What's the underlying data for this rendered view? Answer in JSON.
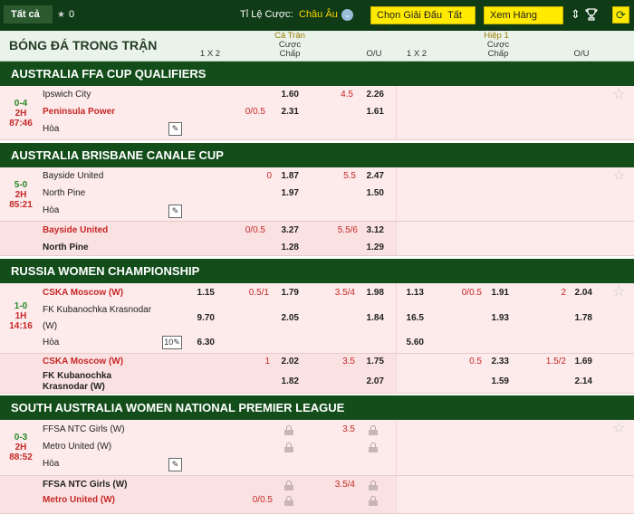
{
  "topbar": {
    "tab_all": "Tất cả",
    "count": "0",
    "odds_label": "Tỉ Lệ Cược:",
    "odds_value": "Châu Âu",
    "choose_league_button": "Chọn Giải Đấu",
    "choose_league_value": "Tất cả",
    "view_single_button": "Xem Hàng Đơn"
  },
  "header": {
    "title": "BÓNG ĐÁ TRONG TRẬN",
    "full_time": "Cả Trận",
    "first_half": "Hiệp 1",
    "col_1x2": "1 X 2",
    "col_handicap_line1": "Cược",
    "col_handicap_line2": "Chấp",
    "col_ou": "O/U"
  },
  "leagues": [
    {
      "name": "AUSTRALIA FFA CUP QUALIFIERS"
    },
    {
      "name": "AUSTRALIA BRISBANE CANALE CUP"
    },
    {
      "name": "RUSSIA WOMEN CHAMPIONSHIP"
    },
    {
      "name": "SOUTH AUSTRALIA WOMEN NATIONAL PREMIER LEAGUE"
    }
  ],
  "matches": {
    "m1": {
      "score": "0-4",
      "period": "2H",
      "clock": "87:46",
      "home": "Ipswich City",
      "away": "Peninsula Power",
      "draw": "Hòa",
      "hc_line": "0/0.5",
      "hc_home": "1.60",
      "hc_away": "2.31",
      "ou_line": "4.5",
      "ou_over": "2.26",
      "ou_under": "1.61"
    },
    "m2": {
      "score": "5-0",
      "period": "2H",
      "clock": "85:21",
      "home": "Bayside United",
      "away": "North Pine",
      "draw": "Hòa",
      "hc_line": "0",
      "hc_home": "1.87",
      "hc_away": "1.97",
      "ou_line": "5.5",
      "ou_over": "2.47",
      "ou_under": "1.50",
      "alt_home": "Bayside United",
      "alt_away": "North Pine",
      "alt_hc_line": "0/0.5",
      "alt_hc_home": "3.27",
      "alt_hc_away": "1.28",
      "alt_ou_line": "5.5/6",
      "alt_ou_over": "3.12",
      "alt_ou_under": "1.29"
    },
    "m3": {
      "score": "1-0",
      "period": "1H",
      "clock": "14:16",
      "home": "CSKA Moscow (W)",
      "away_line1": "FK Kubanochka Krasnodar",
      "away_line2": "(W)",
      "draw": "Hòa",
      "ft_1x2_home": "1.15",
      "ft_1x2_away": "9.70",
      "ft_1x2_draw": "6.30",
      "hc_line": "0.5/1",
      "hc_home": "1.79",
      "hc_away": "2.05",
      "ou_line": "3.5/4",
      "ou_over": "1.98",
      "ou_under": "1.84",
      "h1_1x2_home": "1.13",
      "h1_1x2_away": "16.5",
      "h1_1x2_draw": "5.60",
      "h1_hc_line": "0/0.5",
      "h1_hc_home": "1.91",
      "h1_hc_away": "1.93",
      "h1_ou_line": "2",
      "h1_ou_over": "2.04",
      "h1_ou_under": "1.78",
      "alt_home": "CSKA Moscow (W)",
      "alt_away_line1": "FK Kubanochka",
      "alt_away_line2": "Krasnodar (W)",
      "alt_hc_line": "1",
      "alt_hc_home": "2.02",
      "alt_hc_away": "1.82",
      "alt_ou_line": "3.5",
      "alt_ou_over": "1.75",
      "alt_ou_under": "2.07",
      "alt_h1_hc_line": "0.5",
      "alt_h1_hc_home": "2.33",
      "alt_h1_hc_away": "1.59",
      "alt_h1_ou_line": "1.5/2",
      "alt_h1_ou_over": "1.69",
      "alt_h1_ou_under": "2.14"
    },
    "m4": {
      "score": "0-3",
      "period": "2H",
      "clock": "88:52",
      "home": "FFSA NTC Girls (W)",
      "away": "Metro United (W)",
      "draw": "Hòa",
      "ou_line": "3.5",
      "alt_home": "FFSA NTC Girls (W)",
      "alt_away": "Metro United (W)",
      "alt_hc_line": "0/0.5",
      "alt_ou_line": "3.5/4"
    }
  },
  "icons": {
    "tv": "live-stream-icon",
    "star": "favorite-star-icon",
    "lock": "lock-icon",
    "refresh": "refresh-icon",
    "cup": "trophy-icon",
    "sort": "sort-icon"
  },
  "m3_extra": {
    "more_markets": "10"
  },
  "colors": {
    "topbar": "#0f3b17",
    "league": "#124d1a",
    "row": "#fdeaea",
    "accent_yellow": "#ffea00",
    "team_red": "#c62828"
  }
}
